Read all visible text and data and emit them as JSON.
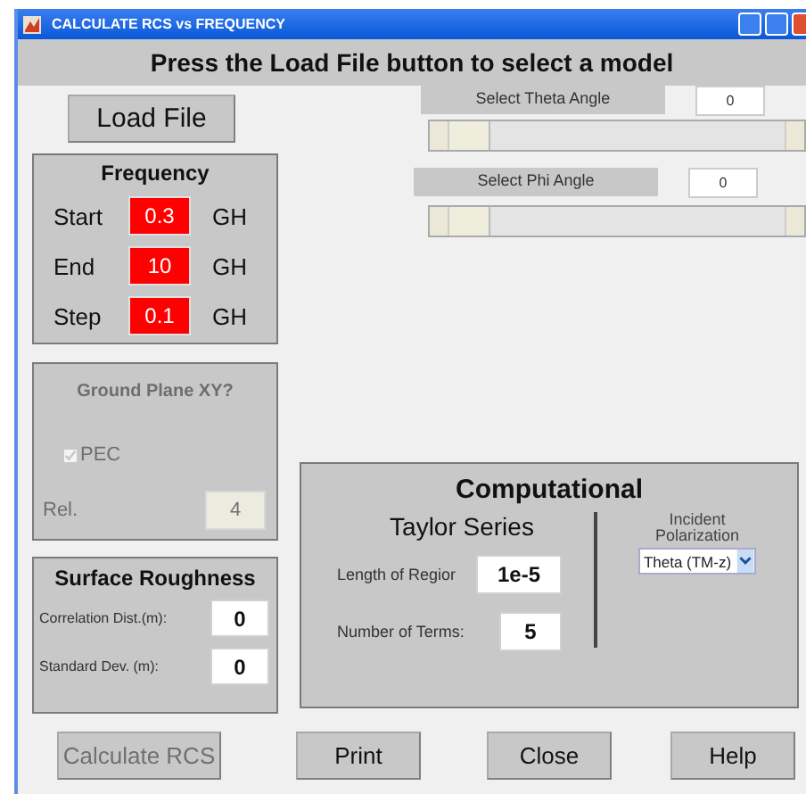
{
  "window": {
    "title": "CALCULATE RCS vs FREQUENCY"
  },
  "header": "Press the Load File button to select a model",
  "load_button": "Load File",
  "frequency": {
    "title": "Frequency",
    "rows": [
      {
        "label": "Start",
        "value": "0.3",
        "unit": "GH"
      },
      {
        "label": "End",
        "value": "10",
        "unit": "GH"
      },
      {
        "label": "Step",
        "value": "0.1",
        "unit": "GH"
      }
    ]
  },
  "ground_plane": {
    "title": "Ground Plane XY?",
    "disabled": true,
    "pec": {
      "label": "PEC",
      "checked": true
    },
    "rel": {
      "label": "Rel.",
      "value": "4"
    }
  },
  "surface_roughness": {
    "title": "Surface Roughness",
    "fields": [
      {
        "label": "Correlation Dist.(m):",
        "value": "0"
      },
      {
        "label": "Standard Dev. (m):",
        "value": "0"
      }
    ]
  },
  "angles": [
    {
      "label": "Select Theta Angle",
      "value": "0"
    },
    {
      "label": "Select Phi Angle",
      "value": "0"
    }
  ],
  "computational": {
    "title": "Computational",
    "method": "Taylor Series",
    "fields": [
      {
        "label": "Length of Regior",
        "value": "1e-5"
      },
      {
        "label": "Number of Terms:",
        "value": "5"
      }
    ],
    "polarization": {
      "label": "Incident Polarization",
      "value": "Theta (TM-z)"
    }
  },
  "buttons": [
    {
      "label": "Calculate RCS",
      "disabled": true
    },
    {
      "label": "Print",
      "disabled": false
    },
    {
      "label": "Close",
      "disabled": false
    },
    {
      "label": "Help",
      "disabled": false
    }
  ]
}
